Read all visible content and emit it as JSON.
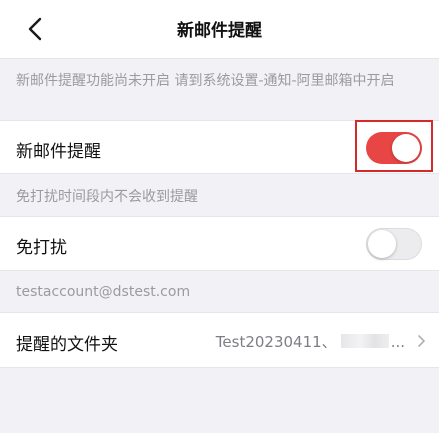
{
  "header": {
    "title": "新邮件提醒"
  },
  "notice": {
    "text": "新邮件提醒功能尚未开启 请到系统设置-通知-阿里邮箱中开启"
  },
  "new_mail_alert": {
    "label": "新邮件提醒",
    "enabled": true,
    "switch_color": "#e84545"
  },
  "dnd_hint": {
    "text": "免打扰时间段内不会收到提醒"
  },
  "dnd": {
    "label": "免打扰",
    "enabled": false
  },
  "account": {
    "email": "testaccount@dstest.com"
  },
  "folders": {
    "label": "提醒的文件夹",
    "value_prefix": "Test20230411、",
    "value_suffix": "..."
  },
  "annotation": {
    "highlight_color": "#d42a2a"
  }
}
